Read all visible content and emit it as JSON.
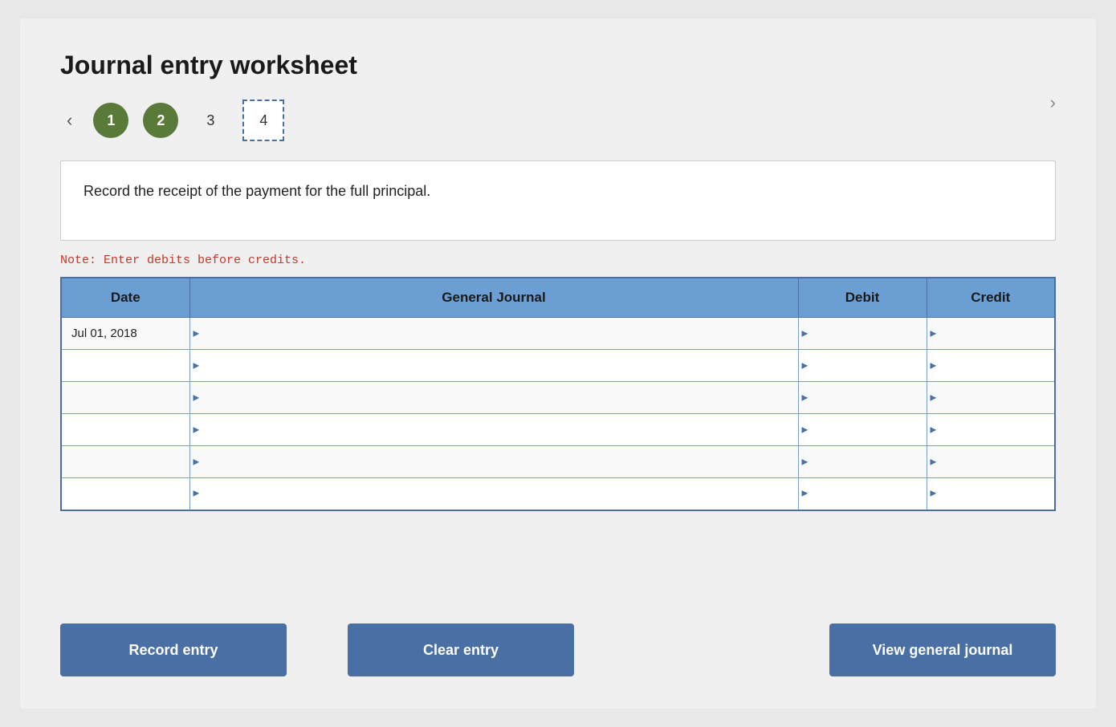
{
  "page": {
    "title": "Journal entry worksheet",
    "note": "Note: Enter debits before credits.",
    "instruction": "Record the receipt of the payment for the full principal.",
    "nav": {
      "prev_arrow": "‹",
      "next_arrow": "›",
      "steps": [
        {
          "label": "1",
          "state": "completed"
        },
        {
          "label": "2",
          "state": "completed"
        },
        {
          "label": "3",
          "state": "plain"
        },
        {
          "label": "4",
          "state": "selected"
        }
      ]
    },
    "table": {
      "headers": [
        "Date",
        "General Journal",
        "Debit",
        "Credit"
      ],
      "rows": [
        {
          "date": "Jul 01, 2018",
          "journal": "",
          "debit": "",
          "credit": ""
        },
        {
          "date": "",
          "journal": "",
          "debit": "",
          "credit": ""
        },
        {
          "date": "",
          "journal": "",
          "debit": "",
          "credit": ""
        },
        {
          "date": "",
          "journal": "",
          "debit": "",
          "credit": ""
        },
        {
          "date": "",
          "journal": "",
          "debit": "",
          "credit": ""
        },
        {
          "date": "",
          "journal": "",
          "debit": "",
          "credit": ""
        }
      ]
    },
    "buttons": {
      "record_label": "Record entry",
      "clear_label": "Clear entry",
      "view_label": "View general journal"
    }
  }
}
